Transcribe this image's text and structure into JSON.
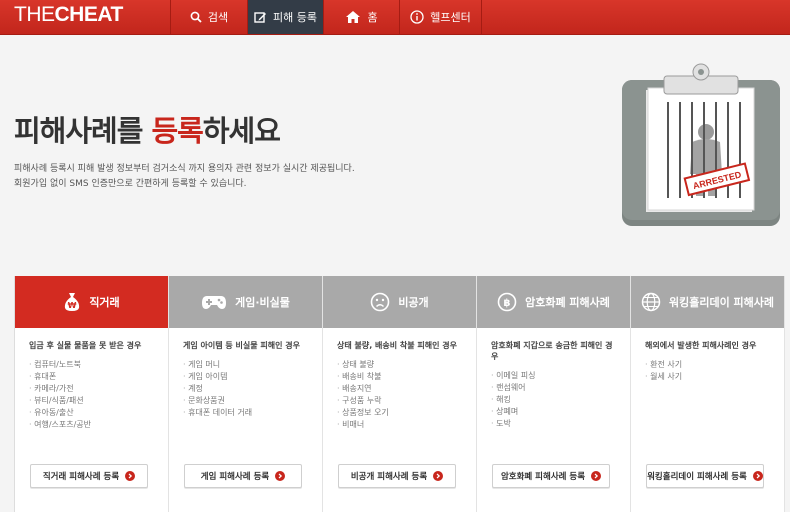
{
  "logo": {
    "part1": "THE",
    "part2": "CHEAT"
  },
  "nav": [
    {
      "label": "검색",
      "icon": "search-icon"
    },
    {
      "label": "피해 등록",
      "icon": "edit-icon",
      "active": true
    },
    {
      "label": "홈",
      "icon": "home-icon"
    },
    {
      "label": "헬프센터",
      "icon": "info-icon"
    }
  ],
  "hero": {
    "title_before": "피해사례를 ",
    "title_accent": "등록",
    "title_after": "하세요",
    "desc_line1": "피해사례 등록시 피해 발생 정보부터 검거소식 까지 용의자 관련 정보가 실시간 제공됩니다.",
    "desc_line2": "회원가입 없이 SMS 인증만으로 간편하게 등록할 수 있습니다.",
    "badge": "ARRESTED"
  },
  "colors": {
    "brand": "#c8261c",
    "nav_active": "#333c47",
    "card_inactive": "#a9a9a9"
  },
  "categories": [
    {
      "title": "직거래",
      "icon": "money-bag-icon",
      "active": true,
      "subtitle": "입금 후 실물 물품을 못 받은 경우",
      "items": [
        "컴퓨터/노트북",
        "휴대폰",
        "카메라/가전",
        "뷰티/식품/패션",
        "유아동/출산",
        "여행/스포츠/공반"
      ],
      "button": "직거래 피해사례 등록"
    },
    {
      "title": "게임·비실물",
      "icon": "gamepad-icon",
      "subtitle": "게임 아이템 등 비실물 피해인 경우",
      "items": [
        "게임 머니",
        "게임 아이템",
        "계정",
        "문화상품권",
        "휴대폰 데이터 거래"
      ],
      "button": "게임 피해사례 등록"
    },
    {
      "title": "비공개",
      "icon": "sad-face-icon",
      "subtitle": "상태 불량, 배송비 착불 피해인 경우",
      "items": [
        "상태 불량",
        "배송비 착불",
        "배송지연",
        "구성품 누락",
        "상품정보 오기",
        "비매너"
      ],
      "button": "비공개 피해사례 등록"
    },
    {
      "title": "암호화폐 피해사례",
      "icon": "bitcoin-icon",
      "subtitle": "암호화폐 지갑으로 송금한 피해인 경우",
      "items": [
        "이메일 피싱",
        "랜섬웨어",
        "해킹",
        "상폐며",
        "도박"
      ],
      "button": "암호화폐 피해사례 등록"
    },
    {
      "title": "워킹홀리데이 피해사례",
      "icon": "globe-icon",
      "subtitle": "해외에서 발생한 피해사례인 경우",
      "items": [
        "환전 사기",
        "월세 사기"
      ],
      "button": "워킹홀리데이 피해사례 등록"
    }
  ]
}
